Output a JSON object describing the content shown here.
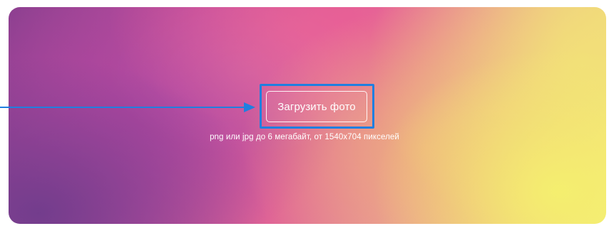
{
  "upload": {
    "button_label": "Загрузить фото",
    "hint": "png или jpg до 6 мегабайт, от 1540x704 пикселей"
  },
  "colors": {
    "highlight": "#1f7fe0",
    "gradient_start": "#8a3f8f",
    "gradient_mid": "#e06496",
    "gradient_end": "#f3ec78"
  },
  "icons": {
    "pointer": "arrow-right-icon"
  }
}
